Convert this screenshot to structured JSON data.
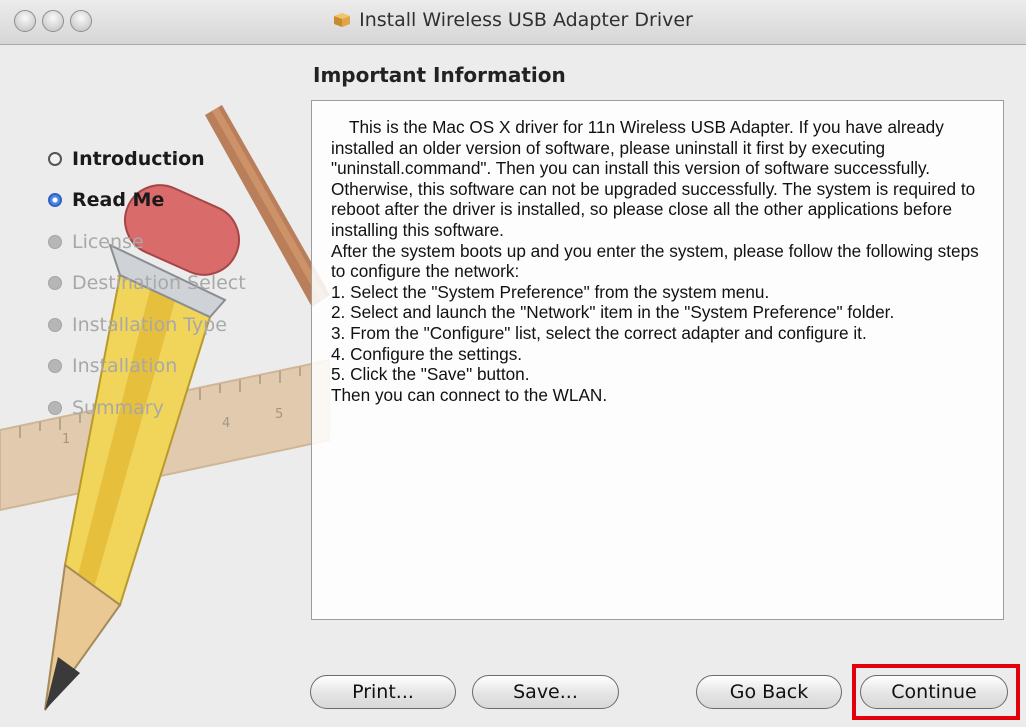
{
  "window": {
    "title": "Install Wireless USB Adapter Driver"
  },
  "main": {
    "heading": "Important Information"
  },
  "steps": [
    {
      "label": "Introduction",
      "state": "done"
    },
    {
      "label": "Read Me",
      "state": "current"
    },
    {
      "label": "License",
      "state": "pending"
    },
    {
      "label": "Destination Select",
      "state": "pending"
    },
    {
      "label": "Installation Type",
      "state": "pending"
    },
    {
      "label": "Installation",
      "state": "pending"
    },
    {
      "label": "Summary",
      "state": "pending"
    }
  ],
  "readme": {
    "intro": "This is the Mac OS X driver for 11n Wireless USB Adapter. If you have already installed an older version of software, please uninstall it first by executing \"uninstall.command\". Then you can install this version of software successfully. Otherwise, this software can not be upgraded successfully. The system is required to reboot after the driver is installed, so please close all the other applications before installing this software.",
    "lead": "After the system boots up and you enter the system, please follow the following steps to configure the network:",
    "step1": "1. Select the \"System Preference\" from the system menu.",
    "step2": "2. Select and launch the \"Network\" item in the \"System Preference\" folder.",
    "step3": "3. From the \"Configure\" list, select the correct adapter and configure it.",
    "step4": "4. Configure the settings.",
    "step5": "5. Click the \"Save\" button.",
    "closing": "Then you can connect to the WLAN."
  },
  "buttons": {
    "print": "Print...",
    "save": "Save...",
    "go_back": "Go Back",
    "continue": "Continue"
  },
  "ruler_numbers": [
    "1",
    "4",
    "5"
  ],
  "colors": {
    "highlight": "#e3000b",
    "current_step_bullet": "#4f88e6"
  }
}
